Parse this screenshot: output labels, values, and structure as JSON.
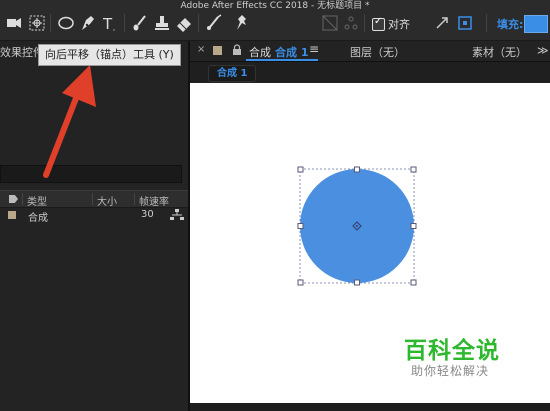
{
  "app": {
    "title": "Adobe After Effects CC 2018 - 无标题项目 *"
  },
  "toolbar": {
    "tools": [
      "camera-tool-icon",
      "pan-behind-tool-icon",
      "ellipse-tool-icon",
      "pen-tool-icon",
      "type-tool-icon",
      "brush-tool-icon",
      "clone-stamp-tool-icon",
      "eraser-tool-icon",
      "roto-brush-tool-icon",
      "puppet-pin-tool-icon"
    ],
    "align_label": "对齐",
    "align_checked": true,
    "fill_label": "填充:",
    "fill_color": "#3a8ee6"
  },
  "tooltip": {
    "text": "向后平移（锚点）工具 (Y)"
  },
  "left_panel": {
    "tab_label": "效果控件",
    "columns": [
      "类型",
      "大小",
      "帧速率"
    ],
    "rows": [
      {
        "name": "合成",
        "fps": "30"
      }
    ]
  },
  "comp_panel": {
    "tab_close": "×",
    "tab_prefix": "合成",
    "tab_name": "合成 1",
    "tab_menu": "≡",
    "layer_tab": "图层（无）",
    "footage_tab": "素材（无）",
    "more": "≫",
    "subtab": "合成 1"
  },
  "shape": {
    "fill": "#4a8fe0",
    "kind": "circle"
  },
  "watermark": {
    "main": "百科全说",
    "sub": "助你轻松解决"
  },
  "colors": {
    "accent": "#3a8ee6",
    "arrow": "#e0402a",
    "watermark": "#2eb82e"
  }
}
